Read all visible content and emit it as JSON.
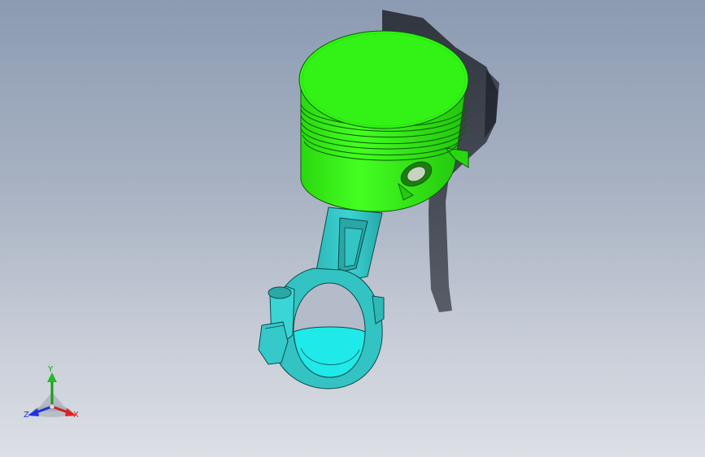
{
  "viewport": {
    "background_top": "#8c9bb2",
    "background_bottom": "#dcdfe5"
  },
  "model": {
    "piston_color": "#33f316",
    "piston_edge_color": "#0b5a05",
    "rod_color": "#35c9c9",
    "rod_edge_color": "#0b4a4a",
    "bearing_color": "#1fe9e9",
    "shadow_color": "#2a2e36"
  },
  "triad": {
    "x_label": "X",
    "y_label": "Y",
    "z_label": "Z",
    "x_color": "#cc2222",
    "y_color": "#1a9a1a",
    "z_color": "#2233cc"
  }
}
